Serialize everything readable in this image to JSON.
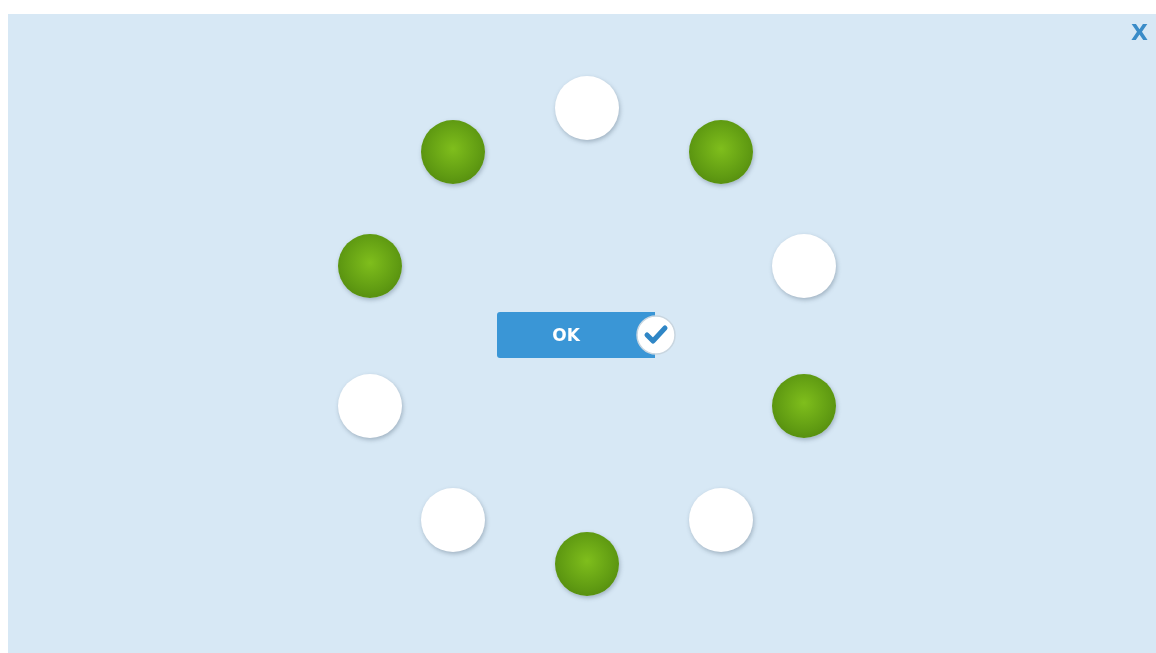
{
  "close_button": {
    "label": "X"
  },
  "dots": [
    {
      "filled": false
    },
    {
      "filled": true
    },
    {
      "filled": false
    },
    {
      "filled": true
    },
    {
      "filled": false
    },
    {
      "filled": true
    },
    {
      "filled": false
    },
    {
      "filled": false
    },
    {
      "filled": true
    },
    {
      "filled": true
    }
  ],
  "ok_button": {
    "label": "OK"
  }
}
